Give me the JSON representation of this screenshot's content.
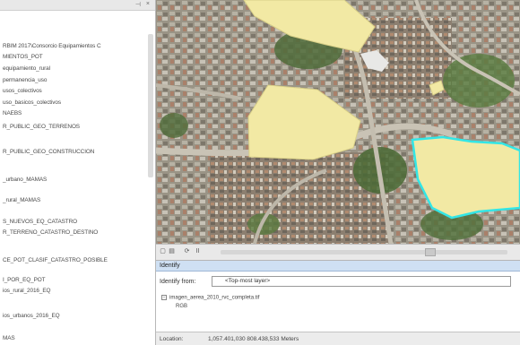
{
  "toc": {
    "items": [
      "RBIM 2017\\Consorcio Equipamientos C",
      "MIENTOS_POT",
      "equipamiento_rural",
      "permanencia_uso",
      "usos_colectivos",
      "uso_basicos_colectivos",
      "NAEBS",
      "R_PUBLIC_GEO_TERRENOS",
      "R_PUBLIC_GEO_CONSTRUCCION",
      "_urbano_MAMAS",
      "_rural_MAMAS",
      "S_NUEVOS_EQ_CATASTRO",
      "R_TERRENO_CATASTRO_DESTINO",
      "CE_POT_CLASIF_CATASTRO_POSIBLE",
      "I_POR_EQ_POT",
      "ios_rural_2016_EQ",
      "ios_urbanos_2016_EQ",
      "MAS"
    ],
    "pin_glyph": "⊣",
    "close_glyph": "×"
  },
  "map": {
    "polygon_fill": "#f2e9a4",
    "selection_outline": "#33e6e6"
  },
  "toolbar": {
    "btn1": "▢",
    "btn2": "▤",
    "btn3": "⟳",
    "btn4": "II"
  },
  "identify": {
    "title": "Identify",
    "from_label": "Identify from:",
    "layer_value": "<Top-most layer>",
    "tree_root": "imagen_aerea_2010_rvc_completa.tif",
    "tree_child": "RGB"
  },
  "status": {
    "location_label": "Location:",
    "location_value": "1,057.401,030  808.438,533 Meters"
  }
}
